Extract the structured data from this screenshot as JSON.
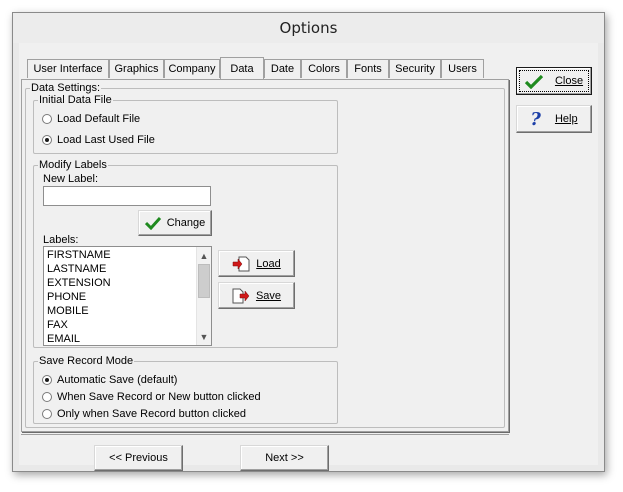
{
  "window": {
    "title": "Options"
  },
  "tabs": [
    {
      "label": "User Interface"
    },
    {
      "label": "Graphics"
    },
    {
      "label": "Company"
    },
    {
      "label": "Data"
    },
    {
      "label": "Date"
    },
    {
      "label": "Colors"
    },
    {
      "label": "Fonts"
    },
    {
      "label": "Security"
    },
    {
      "label": "Users"
    }
  ],
  "active_tab": "Data",
  "data_settings": {
    "legend": "Data Settings:",
    "initial_data_file": {
      "legend": "Initial Data File",
      "options": [
        {
          "label": "Load Default File",
          "checked": false
        },
        {
          "label": "Load Last Used File",
          "checked": true
        }
      ]
    },
    "modify_labels": {
      "legend": "Modify Labels",
      "new_label_caption": "New Label:",
      "new_label_value": "",
      "change_button": "Change",
      "labels_caption": "Labels:",
      "labels": [
        "FIRSTNAME",
        "LASTNAME",
        "EXTENSION",
        "PHONE",
        "MOBILE",
        "FAX",
        "EMAIL"
      ],
      "load_button": "Load",
      "save_button": "Save"
    },
    "save_record_mode": {
      "legend": "Save Record Mode",
      "options": [
        {
          "label": "Automatic Save (default)",
          "checked": true
        },
        {
          "label": "When Save Record or New button clicked",
          "checked": false
        },
        {
          "label": "Only when Save Record button clicked",
          "checked": false
        }
      ]
    }
  },
  "side_buttons": {
    "close": "Close",
    "help": "Help"
  },
  "nav_buttons": {
    "previous": "<< Previous",
    "next": "Next >>"
  },
  "colors": {
    "check_green": "#1f8a1f",
    "help_blue": "#1c3fa8",
    "arrow_red": "#d01818"
  }
}
